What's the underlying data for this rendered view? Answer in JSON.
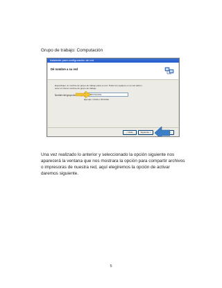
{
  "document": {
    "heading": "Grupo de trabajo: Computación",
    "paragraph": "Una vez realizado lo anterior y seleccionado la opción siguiente nos aparecerá la ventana que nos mostrara la opción para compartir archivos o impresoras de nuestra red, aquí elegiremos la opción de activar daremos siguiente.",
    "page_number": "5"
  },
  "screenshot": {
    "window_title": "Asistente para configuración de red",
    "header_title": "Dé nombre a su red",
    "description": "Especifique un nombre de grupo de trabajo para su red. Todos los equipos en su red deben tener el mismo nombre de grupo de trabajo.",
    "workgroup_label": "Nombre del grupo de trabajo:",
    "workgroup_value": "COMPUTACION",
    "example_text": "Ejemplo: CASA u OFICINA",
    "buttons": {
      "back": "< Atrás",
      "next": "Siguiente >",
      "cancel": "Cancelar"
    },
    "colors": {
      "titlebar": "#245ccc",
      "highlight_arrow": "#f2c230",
      "next_arrow": "#3d7fc6"
    }
  }
}
